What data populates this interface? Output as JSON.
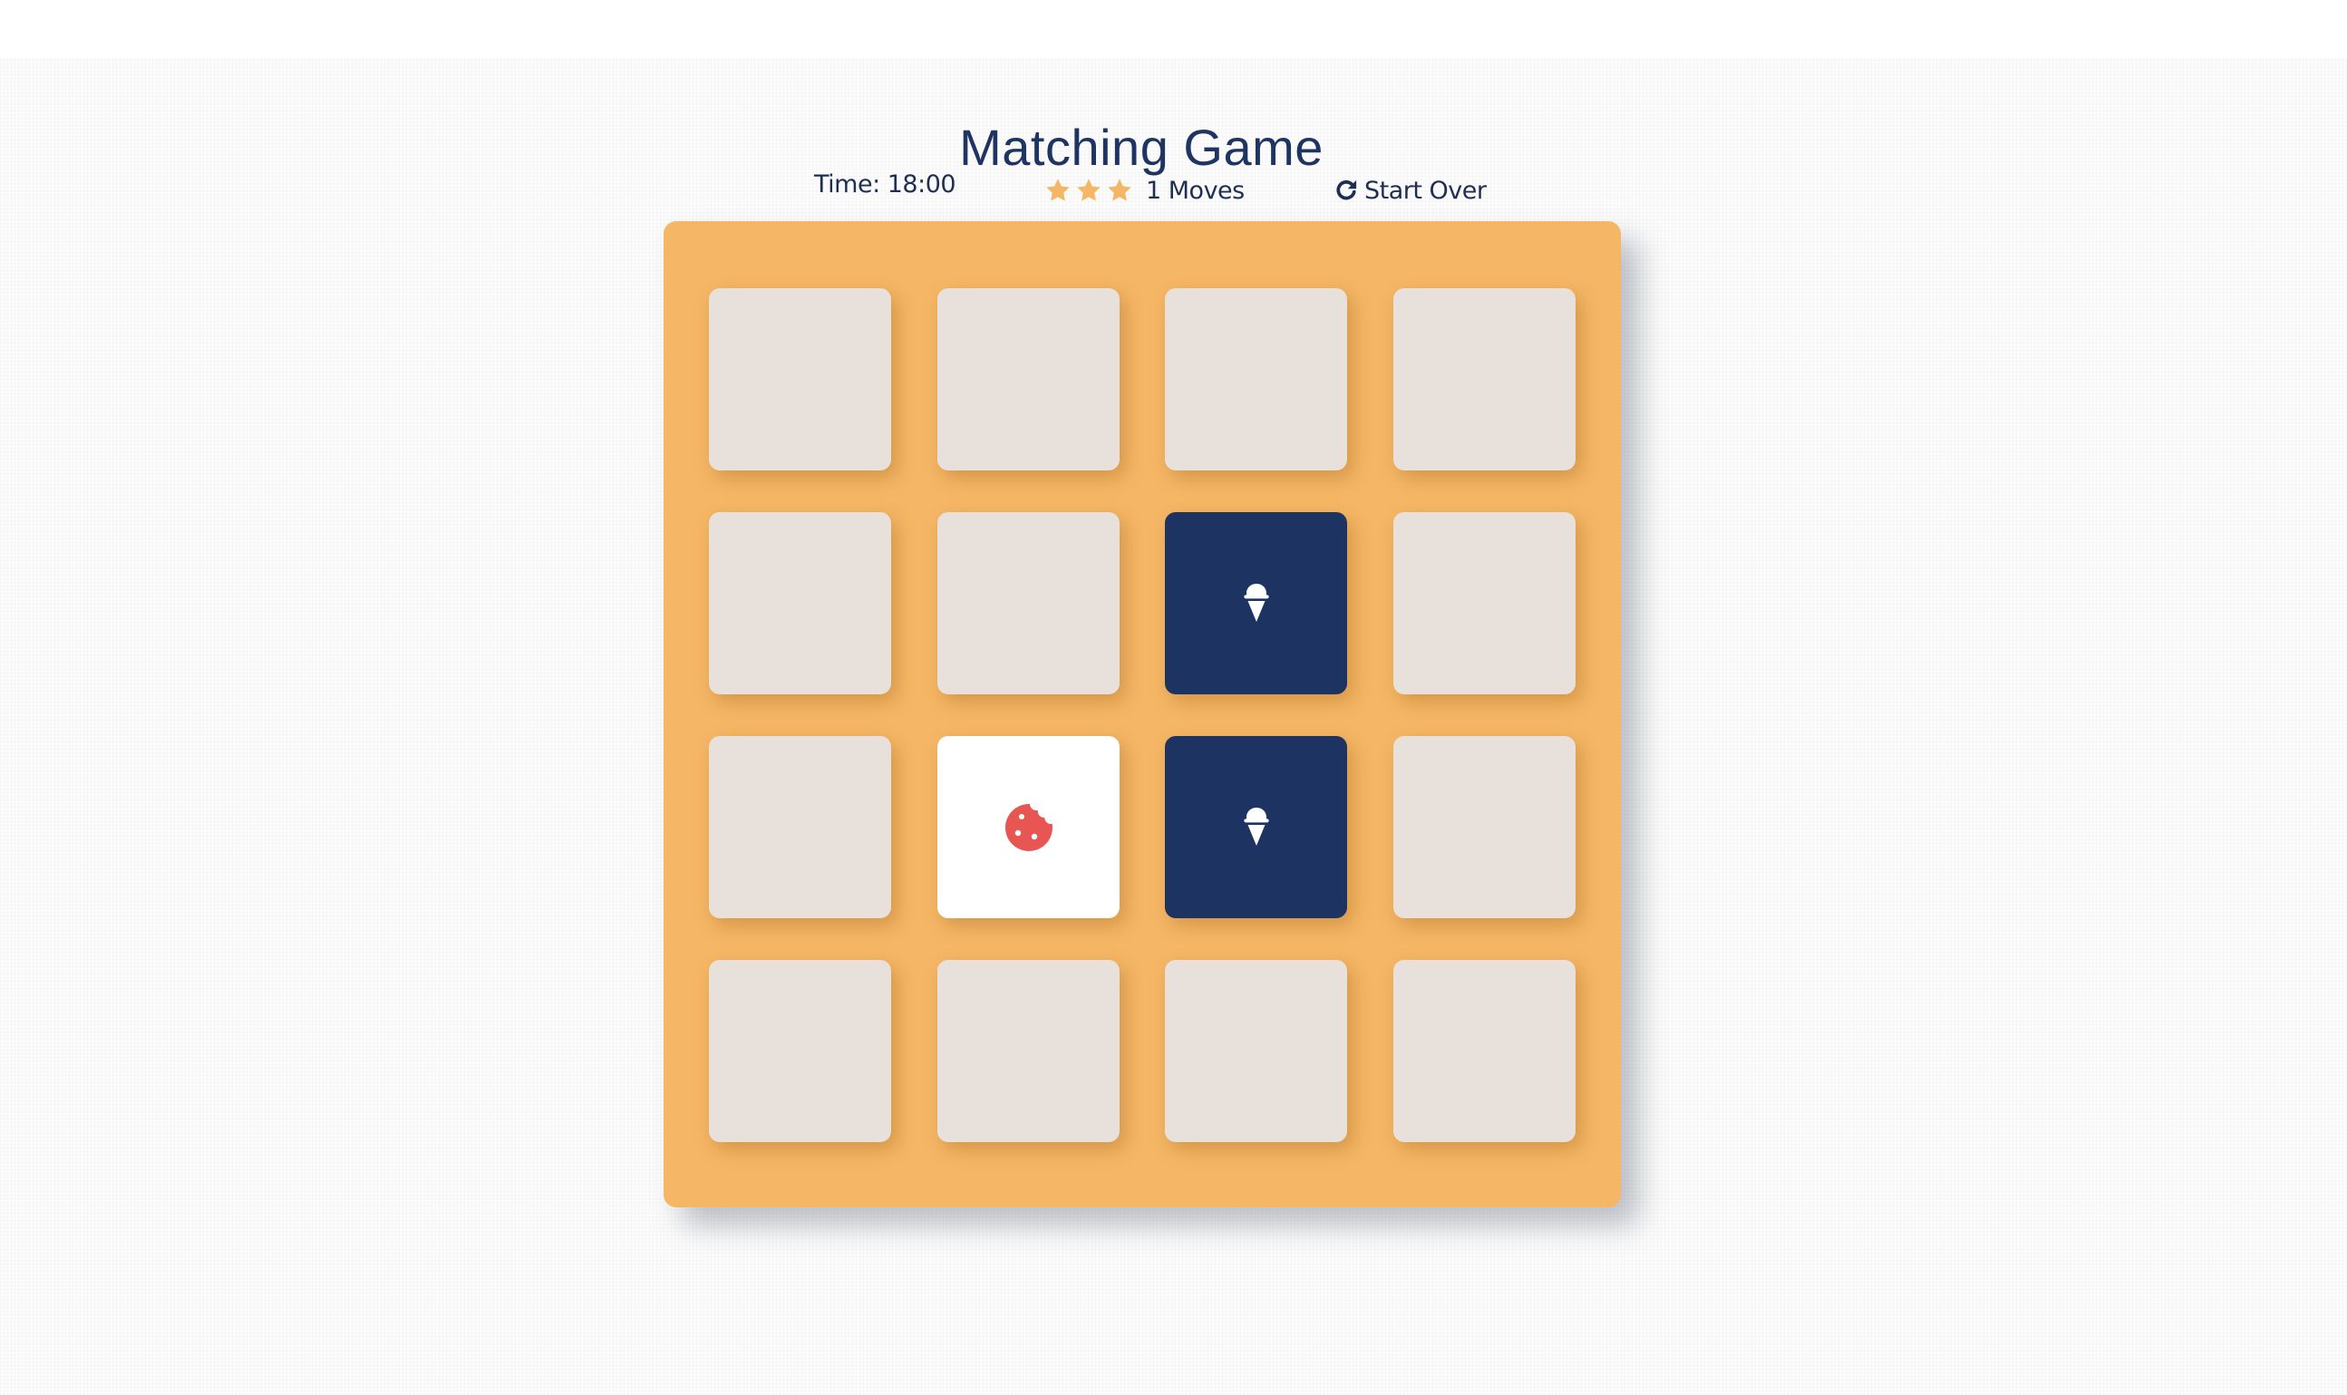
{
  "title": "Matching Game",
  "score_panel": {
    "timer": "Time: 18:00",
    "stars": 3,
    "moves": "1 Moves",
    "restart_label": "Start Over",
    "restart_icon": "redo-icon",
    "star_icon": "star-icon"
  },
  "colors": {
    "deck": "#f5b765",
    "card_closed": "#e8e1db",
    "card_open": "#1d3362",
    "card_show": "#ffffff",
    "text": "#1e3563",
    "star": "#f5b765",
    "cookie": "#e85653"
  },
  "deck": {
    "rows": 4,
    "cols": 4,
    "cards": [
      {
        "state": "closed",
        "icon": ""
      },
      {
        "state": "closed",
        "icon": ""
      },
      {
        "state": "closed",
        "icon": ""
      },
      {
        "state": "closed",
        "icon": ""
      },
      {
        "state": "closed",
        "icon": ""
      },
      {
        "state": "closed",
        "icon": ""
      },
      {
        "state": "open",
        "icon": "ice-cream-icon"
      },
      {
        "state": "closed",
        "icon": ""
      },
      {
        "state": "closed",
        "icon": ""
      },
      {
        "state": "show",
        "icon": "cookie-icon"
      },
      {
        "state": "open",
        "icon": "ice-cream-icon"
      },
      {
        "state": "closed",
        "icon": ""
      },
      {
        "state": "closed",
        "icon": ""
      },
      {
        "state": "closed",
        "icon": ""
      },
      {
        "state": "closed",
        "icon": ""
      },
      {
        "state": "closed",
        "icon": ""
      }
    ]
  }
}
